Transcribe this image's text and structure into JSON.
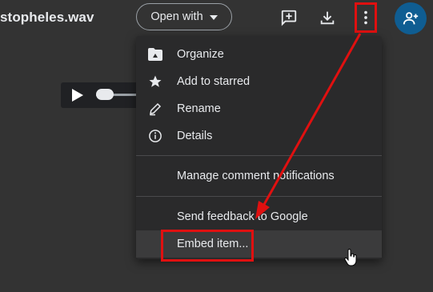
{
  "header": {
    "filename": "stopheles.wav",
    "open_with_label": "Open with"
  },
  "toolbar_icons": [
    "add-comment-icon",
    "download-icon",
    "more-vert-icon",
    "share-person-add-icon"
  ],
  "menu": {
    "items": [
      {
        "label": "Organize",
        "icon": "drive-folder-icon"
      },
      {
        "label": "Add to starred",
        "icon": "star-icon"
      },
      {
        "label": "Rename",
        "icon": "pencil-icon"
      },
      {
        "label": "Details",
        "icon": "info-icon"
      },
      {
        "label": "Manage comment notifications"
      },
      {
        "label": "Send feedback to Google"
      },
      {
        "label": "Embed item..."
      }
    ]
  },
  "colors": {
    "background": "#333333",
    "menu_background": "#2a2a2b",
    "annotation_red": "#e01010",
    "share_button": "#0f5d92"
  }
}
